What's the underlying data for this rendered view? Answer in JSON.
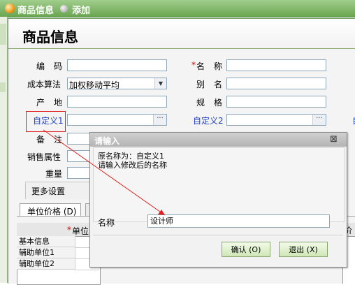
{
  "tab_bar": {
    "window_title": "商品信息",
    "add_label": "添加"
  },
  "page": {
    "title": "商品信息"
  },
  "form": {
    "code_label": "编码",
    "name_label": "名称",
    "required_mark": "*",
    "cost_method_label": "成本算法",
    "cost_method_value": "加权移动平均",
    "alias_label": "别名",
    "origin_label": "产地",
    "spec_label": "规格",
    "custom1_label": "自定义1",
    "custom2_label": "自定义2",
    "custom3_partial": "自",
    "remark_label": "备注",
    "sales_attr_label": "销售属性",
    "weight_label": "重量",
    "more_settings": "更多设置",
    "dots": "···"
  },
  "tabs": {
    "unit_price": "单位价格 (D)"
  },
  "grid": {
    "header_partial": "单位",
    "header_right_partial": "价",
    "rows": [
      "基本信息",
      "辅助单位1",
      "辅助单位2"
    ]
  },
  "input_dialog": {
    "title": "请输入",
    "message": "原名称为：自定义1\n请输入修改后的名称",
    "name_label": "名称",
    "name_value": "设计师",
    "ok": "确认 (O)",
    "cancel": "退出 (X)"
  },
  "colors": {
    "header_green": "#6aa550",
    "annotation_red": "#e02020",
    "link_blue": "#2040c0"
  }
}
